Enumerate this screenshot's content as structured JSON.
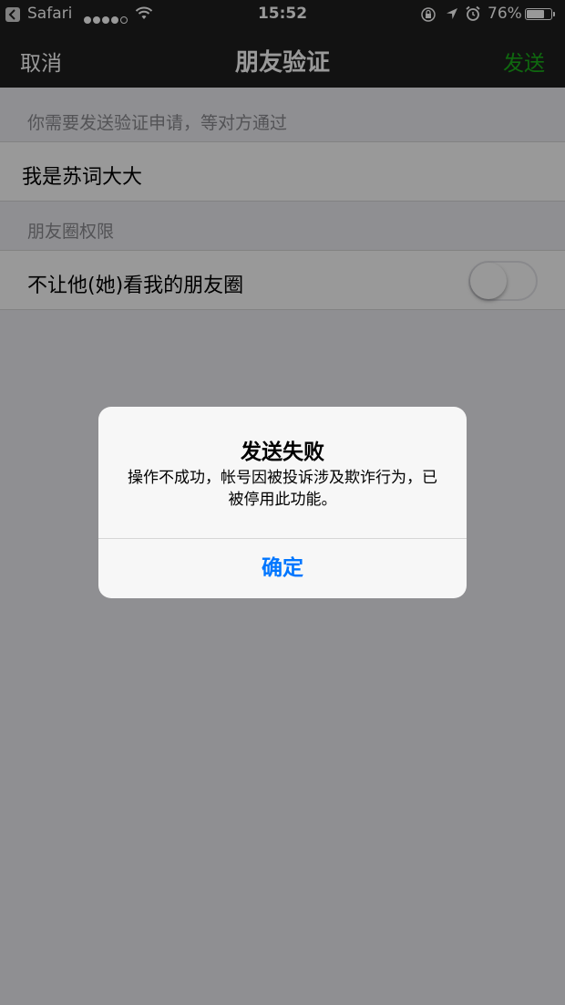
{
  "status_bar": {
    "back_app": "Safari",
    "time": "15:52",
    "battery_percent": "76%",
    "battery_level": 0.76
  },
  "nav": {
    "cancel_label": "取消",
    "title": "朋友验证",
    "send_label": "发送"
  },
  "form": {
    "request_header": "你需要发送验证申请，等对方通过",
    "request_message": "我是苏词大大",
    "moments_header": "朋友圈权限",
    "hide_moments_label": "不让他(她)看我的朋友圈",
    "hide_moments_on": false
  },
  "alert": {
    "title": "发送失败",
    "message": "操作不成功，帐号因被投诉涉及欺诈行为，已被停用此功能。",
    "confirm_label": "确定"
  },
  "colors": {
    "accent_green": "#1aad19",
    "ios_blue": "#0076ff"
  }
}
